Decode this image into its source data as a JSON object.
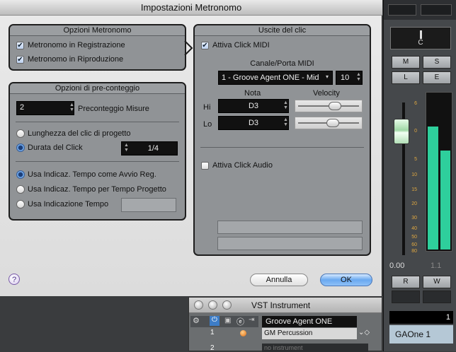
{
  "dialog": {
    "title": "Impostazioni Metronomo",
    "metronome_options": {
      "header": "Opzioni Metronomo",
      "items": [
        {
          "label": "Metronomo in Registrazione",
          "checked": true
        },
        {
          "label": "Metronomo in Riproduzione",
          "checked": true
        }
      ]
    },
    "precount_options": {
      "header": "Opzioni di pre-conteggio",
      "bars_value": "2",
      "bars_label": "Preconteggio Misure",
      "length_radios": [
        {
          "label": "Lunghezza del clic di progetto",
          "selected": false
        },
        {
          "label": "Durata del Click",
          "selected": true
        }
      ],
      "click_duration_value": "1/4",
      "tempo_radios": [
        {
          "label": "Usa Indicaz. Tempo come Avvio Reg.",
          "selected": true
        },
        {
          "label": "Usa Indicaz. Tempo per Tempo Progetto",
          "selected": false
        },
        {
          "label": "Usa Indicazione Tempo",
          "selected": false
        }
      ],
      "time_sig_value": ""
    },
    "click_outputs": {
      "header": "Uscite del clic",
      "midi_click_label": "Attiva Click MIDI",
      "midi_click_checked": true,
      "channel_port_label": "Canale/Porta MIDI",
      "port_value": "1 - Groove Agent ONE - Mid",
      "channel_value": "10",
      "note_header": "Nota",
      "velocity_header": "Velocity",
      "hi_label": "Hi",
      "hi_note": "D3",
      "hi_velocity": 0.62,
      "lo_label": "Lo",
      "lo_note": "D3",
      "lo_velocity": 0.58,
      "audio_click_label": "Attiva Click Audio",
      "audio_click_checked": false
    },
    "buttons": {
      "help": "?",
      "cancel": "Annulla",
      "ok": "OK"
    }
  },
  "channel": {
    "monitor_label": "C",
    "buttons": [
      "M",
      "S",
      "L",
      "E"
    ],
    "scale_labels": [
      "6",
      "0",
      "5",
      "10",
      "15",
      "20",
      "30",
      "40",
      "50",
      "60",
      "80"
    ],
    "fader_value": "0.00",
    "pan_value": "1.1",
    "rw_buttons": [
      "R",
      "W"
    ],
    "number": "1",
    "name": "GAOne 1"
  },
  "vst": {
    "title": "VST Instrument",
    "rows": [
      {
        "num": "",
        "name": "Groove Agent ONE"
      },
      {
        "num": "1",
        "name": "GM Percussion"
      },
      {
        "num": "2",
        "name": "no instrument"
      }
    ]
  }
}
